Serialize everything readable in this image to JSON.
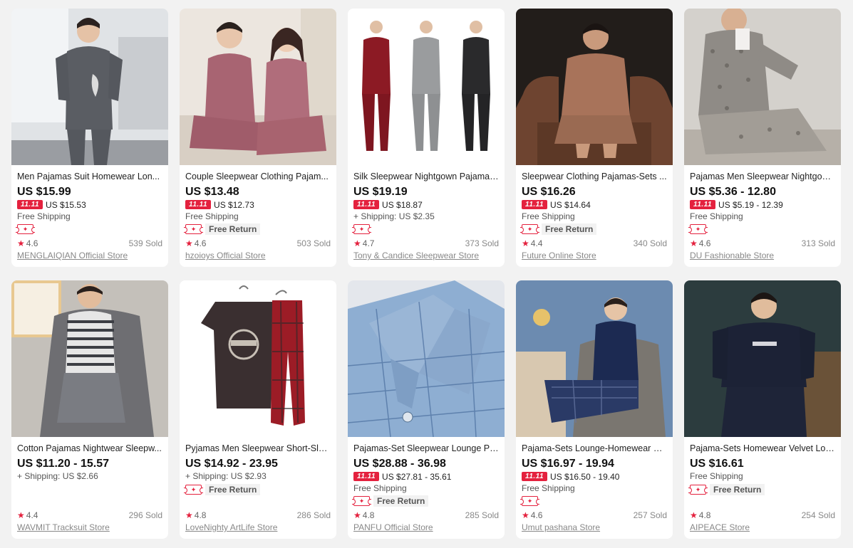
{
  "products": [
    {
      "title": "Men Pajamas Suit Homewear Lon...",
      "price": "US $15.99",
      "promo_tag": "11.11",
      "promo_price": "US $15.53",
      "shipping": "Free Shipping",
      "free_return": "",
      "rating": "4.6",
      "sold": "539 Sold",
      "store": "MENGLAIQIAN Official Store",
      "colors": {
        "bg": "#d9dde0",
        "item": "#5a5d63"
      }
    },
    {
      "title": "Couple Sleepwear Clothing Pajam...",
      "price": "US $13.48",
      "promo_tag": "11.11",
      "promo_price": "US $12.73",
      "shipping": "Free Shipping",
      "free_return": "Free Return",
      "rating": "4.6",
      "sold": "503 Sold",
      "store": "hzoioys Official Store",
      "colors": {
        "bg": "#e8e2dc",
        "item": "#a86472"
      }
    },
    {
      "title": "Silk Sleepwear Nightgown Pajama-...",
      "price": "US $19.19",
      "promo_tag": "11.11",
      "promo_price": "US $18.87",
      "shipping": "+ Shipping: US $2.35",
      "free_return": "",
      "rating": "4.7",
      "sold": "373 Sold",
      "store": "Tony & Candice Sleepwear Store",
      "colors": {
        "bg": "#ffffff",
        "item": "#8c1a24"
      }
    },
    {
      "title": "Sleepwear Clothing Pajamas-Sets ...",
      "price": "US $16.26",
      "promo_tag": "11.11",
      "promo_price": "US $14.64",
      "shipping": "Free Shipping",
      "free_return": "Free Return",
      "rating": "4.4",
      "sold": "340 Sold",
      "store": "Future Online Store",
      "colors": {
        "bg": "#2a2420",
        "item": "#a8735a"
      }
    },
    {
      "title": "Pajamas Men Sleepwear Nightgow...",
      "price": "US $5.36 - 12.80",
      "promo_tag": "11.11",
      "promo_price": "US $5.19 - 12.39",
      "shipping": "Free Shipping",
      "free_return": "",
      "rating": "4.6",
      "sold": "313 Sold",
      "store": "DU Fashionable Store",
      "colors": {
        "bg": "#d6d3cf",
        "item": "#8f8b86"
      }
    },
    {
      "title": "Cotton Pajamas Nightwear Sleepw...",
      "price": "US $11.20 - 15.57",
      "promo_tag": "",
      "promo_price": "",
      "shipping": "+ Shipping: US $2.66",
      "free_return": "",
      "rating": "4.4",
      "sold": "296 Sold",
      "store": "WAVMIT Tracksuit Store",
      "colors": {
        "bg": "#b8b4ae",
        "item": "#4d4f55"
      }
    },
    {
      "title": "Pyjamas Men Sleepwear Short-Sle...",
      "price": "US $14.92 - 23.95",
      "promo_tag": "",
      "promo_price": "",
      "shipping": "+ Shipping: US $2.93",
      "free_return": "Free Return",
      "rating": "4.8",
      "sold": "286 Sold",
      "store": "LoveNighty ArtLife Store",
      "colors": {
        "bg": "#ffffff",
        "item": "#3a2f30"
      }
    },
    {
      "title": "Pajamas-Set Sleepwear Lounge Pjs...",
      "price": "US $28.88 - 36.98",
      "promo_tag": "11.11",
      "promo_price": "US $27.81 - 35.61",
      "shipping": "Free Shipping",
      "free_return": "Free Return",
      "rating": "4.8",
      "sold": "285 Sold",
      "store": "PANFU Official Store",
      "colors": {
        "bg": "#e6e9ee",
        "item": "#7d9ec4"
      }
    },
    {
      "title": "Pajama-Sets Lounge-Homewear Sl...",
      "price": "US $16.97 - 19.94",
      "promo_tag": "11.11",
      "promo_price": "US $16.50 - 19.40",
      "shipping": "Free Shipping",
      "free_return": "",
      "rating": "4.6",
      "sold": "257 Sold",
      "store": "Umut pashana Store",
      "colors": {
        "bg": "#6c8bb0",
        "item": "#1c2a52"
      }
    },
    {
      "title": "Pajama-Sets Homewear Velvet Lon...",
      "price": "US $16.61",
      "promo_tag": "",
      "promo_price": "",
      "shipping": "Free Shipping",
      "free_return": "Free Return",
      "rating": "4.8",
      "sold": "254 Sold",
      "store": "AIPEACE Store",
      "colors": {
        "bg": "#2c3c3e",
        "item": "#1c2236"
      }
    }
  ],
  "icons": {
    "star": "star-icon",
    "coupon": "coupon-icon"
  },
  "accent": "#e4213e"
}
